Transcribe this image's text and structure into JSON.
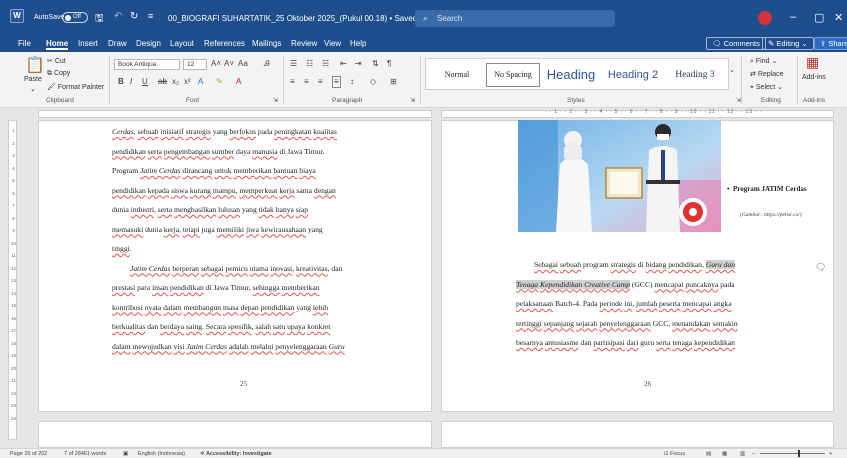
{
  "titlebar": {
    "app_icon": "word-icon",
    "autosave_label": "AutoSave",
    "autosave_state": "Off",
    "doc_title": "00_BIOGRAFI SUHARTATIK_25 Oktober 2025_(Pukul 00.18) • Saved ∨",
    "search_placeholder": "Search",
    "accent": "#1e4e8c"
  },
  "menu": {
    "tabs": [
      "File",
      "Home",
      "Insert",
      "Draw",
      "Design",
      "Layout",
      "References",
      "Mailings",
      "Review",
      "View",
      "Help"
    ],
    "active": "Home",
    "comments_label": "Comments",
    "editing_label": "Editing",
    "share_label": "Share"
  },
  "ribbon": {
    "clipboard": {
      "paste": "Paste",
      "cut": "Cut",
      "copy": "Copy",
      "format_painter": "Format Painter",
      "label": "Clipboard"
    },
    "font": {
      "family": "Book Antiqua",
      "size": "12",
      "label": "Font"
    },
    "paragraph": {
      "label": "Paragraph"
    },
    "styles": {
      "items": [
        "Normal",
        "No Spacing",
        "Heading",
        "Heading 2",
        "Heading 3"
      ],
      "label": "Styles"
    },
    "editing": {
      "find": "Find",
      "replace": "Replace",
      "select": "Select",
      "label": "Editing"
    },
    "addins": {
      "button": "Add-ins",
      "label": "Add-ins"
    }
  },
  "ruler": {
    "numbers": "· · 1 · · 2 · · 3 · · 4 · · 5 · · 6 · · 7 · · 8 · · 9 · · 10 · · 11 · · 12 · · 13 · ·",
    "vertical": [
      "1",
      "2",
      "3",
      "4",
      "5",
      "6",
      "7",
      "8",
      "9",
      "10",
      "11",
      "12",
      "13",
      "14",
      "15",
      "16",
      "17",
      "18",
      "19",
      "20",
      "21",
      "22",
      "23",
      "24"
    ]
  },
  "page25": {
    "lines": [
      [
        "Cerdas",
        ", ",
        "sebuah",
        " ",
        "inisiatif",
        " ",
        "strategis",
        " yang ",
        "berfokus",
        " pada ",
        "peningkatan",
        " ",
        "kualitas"
      ],
      [
        "pendidikan",
        " ",
        "serta",
        " ",
        "pengembangan",
        " ",
        "sumber",
        " daya ",
        "manusia",
        " di Jawa Timur."
      ],
      [
        "Program ",
        "Jatim Cerdas",
        " ",
        "dirancang",
        " ",
        "untuk",
        " ",
        "memberikan",
        " ",
        "bantuan",
        " ",
        "biaya"
      ],
      [
        "pendidikan",
        " ",
        "kepada",
        " ",
        "siswa",
        " ",
        "kurang",
        " ",
        "mampu",
        ", ",
        "memperkuat",
        " ",
        "kerja",
        " sama ",
        "dengan"
      ],
      [
        "dunia ",
        "industri",
        ", ",
        "serta",
        " ",
        "menghasilkan",
        " ",
        "lulusan",
        " yang ",
        "tidak",
        " ",
        "hanya",
        " ",
        "siap"
      ],
      [
        "memasuki",
        " dunia ",
        "kerja",
        ", ",
        "tetapi",
        " juga ",
        "memiliki",
        " ",
        "jiwa",
        " ",
        "kewirausahaan",
        " yang"
      ],
      [
        "tinggi",
        "."
      ],
      [
        "Jatim Cerdas",
        " ",
        "berperan",
        " ",
        "sebagai",
        " ",
        "pemicu",
        " ",
        "utama",
        " ",
        "inovasi",
        ", ",
        "kreativitas",
        ", dan"
      ],
      [
        "prestasi",
        " para ",
        "insan",
        " ",
        "pendidikan",
        " di Jawa Timur, ",
        "sehingga",
        " ",
        "memberikan"
      ],
      [
        "kontribusi",
        " ",
        "nyata",
        " ",
        "dalam",
        " ",
        "membangun",
        " ",
        "masa",
        " ",
        "depan",
        " ",
        "pendidikan",
        " yang ",
        "lebih"
      ],
      [
        "berkualitas",
        " dan ",
        "berdaya",
        " ",
        "saing",
        ". ",
        "Secara",
        " ",
        "spesifik",
        ", ",
        "salah",
        " ",
        "satu",
        " ",
        "upaya",
        " ",
        "konkret"
      ],
      [
        "dalam",
        " ",
        "mewujudkan",
        " ",
        "visi",
        " ",
        "Jatim Cerdas",
        " ",
        "adalah",
        " ",
        "melalui",
        " ",
        "penyelenggaraan",
        " ",
        "Guru"
      ]
    ],
    "page_number": "25"
  },
  "page26": {
    "caption_title": "Program JATIM Cerdas",
    "caption_source": "(Gambar.: https://petisi.co/)",
    "lines": [
      [
        "Sebagai",
        " ",
        "sebuah",
        " program ",
        "strategis",
        " di ",
        "bidang",
        " ",
        "pendidikan",
        ", ",
        "Guru dan"
      ],
      [
        "Tenaga",
        " ",
        "Kependidikan",
        " Creative Camp",
        " (GCC) ",
        "mencapai",
        " ",
        "puncaknya",
        " pada"
      ],
      [
        "pelaksanaan",
        " Batch-4. Pada ",
        "periode",
        " ",
        "ini",
        ", ",
        "jumlah",
        " ",
        "peserta",
        " ",
        "mencapai",
        " ",
        "angka"
      ],
      [
        "tertinggi",
        " ",
        "sepanjang",
        " ",
        "sejarah",
        " ",
        "penyelenggaraan",
        " GCC, ",
        "menandakan",
        " ",
        "semakin"
      ],
      [
        "besarnya",
        " ",
        "antusiasme",
        " dan ",
        "partisipasi",
        " ",
        "dari",
        " guru ",
        "serta",
        " ",
        "tenaga",
        " ",
        "kependidikan"
      ]
    ],
    "page_number": "26"
  },
  "status": {
    "page": "Page 26 of 202",
    "words": "7 of 28461 words",
    "language": "English (Indonesia)",
    "accessibility": "Accessibility: Investigate",
    "focus": "Focus"
  }
}
